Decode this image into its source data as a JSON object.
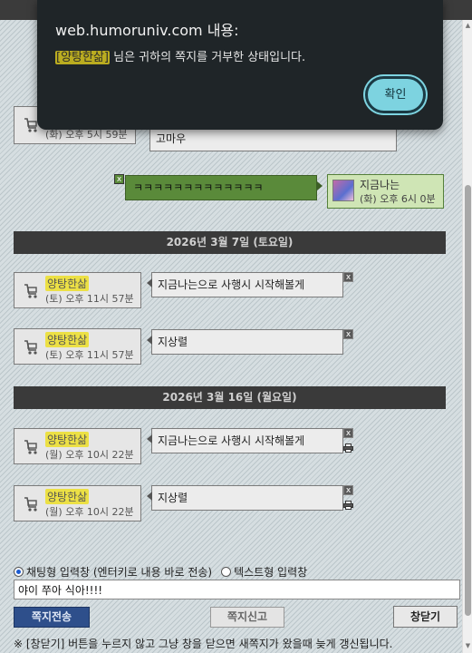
{
  "dialog": {
    "title": "web.humoruniv.com 내용:",
    "message_name": "[양탕한삶]",
    "message_rest": " 님은 귀하의 쪽지를 거부한 상태입니다.",
    "ok_label": "확인"
  },
  "partial_message": {
    "time": "(화) 오후 5시 59분",
    "text": "고마우"
  },
  "my_message": {
    "text": "ㅋㅋㅋㅋㅋㅋㅋㅋㅋㅋㅋㅋㅋ",
    "sender_name": "지금나는",
    "time": "(화) 오후 6시 0분",
    "delete_label": "x"
  },
  "dates": [
    "2026년 3월 7일 (토요일)",
    "2026년 3월 16일 (월요일)"
  ],
  "messages": [
    {
      "sender": "양탕한삶",
      "time": "(토) 오후 11시 57분",
      "text": "지금나는으로 사행시 시작해볼게",
      "delete_label": "x"
    },
    {
      "sender": "양탕한삶",
      "time": "(토) 오후 11시 57분",
      "text": "지상렬",
      "delete_label": "x"
    },
    {
      "sender": "양탕한삶",
      "time": "(월) 오후 10시 22분",
      "text": "지금나는으로 사행시 시작해볼게",
      "delete_label": "x"
    },
    {
      "sender": "양탕한삶",
      "time": "(월) 오후 10시 22분",
      "text": "지상렬",
      "delete_label": "x"
    }
  ],
  "composer": {
    "mode_chat_label": "채팅형 입력창 (엔터키로 내용 바로 전송)",
    "mode_text_label": "텍스트형 입력창",
    "selected_mode": "chat",
    "input_value": "야이 쭈아 식아!!!!",
    "send_label": "쪽지전송",
    "report_label": "쪽지신고",
    "close_label": "창닫기"
  },
  "footnote": "※ [창닫기] 버튼을 누르지 않고 그냥 창을 닫으면 새쪽지가 왔을때 늦게 갱신됩니다.",
  "icons": {
    "cart": "cart-icon",
    "print": "print-icon",
    "avatar": "avatar"
  },
  "colors": {
    "date_bar": "#3a3a3a",
    "highlight": "#ecde28",
    "my_bubble": "#5a8a3a",
    "send_button": "#2e4f8b",
    "dialog_bg": "#1f2528",
    "dialog_button": "#7dd3e0"
  }
}
